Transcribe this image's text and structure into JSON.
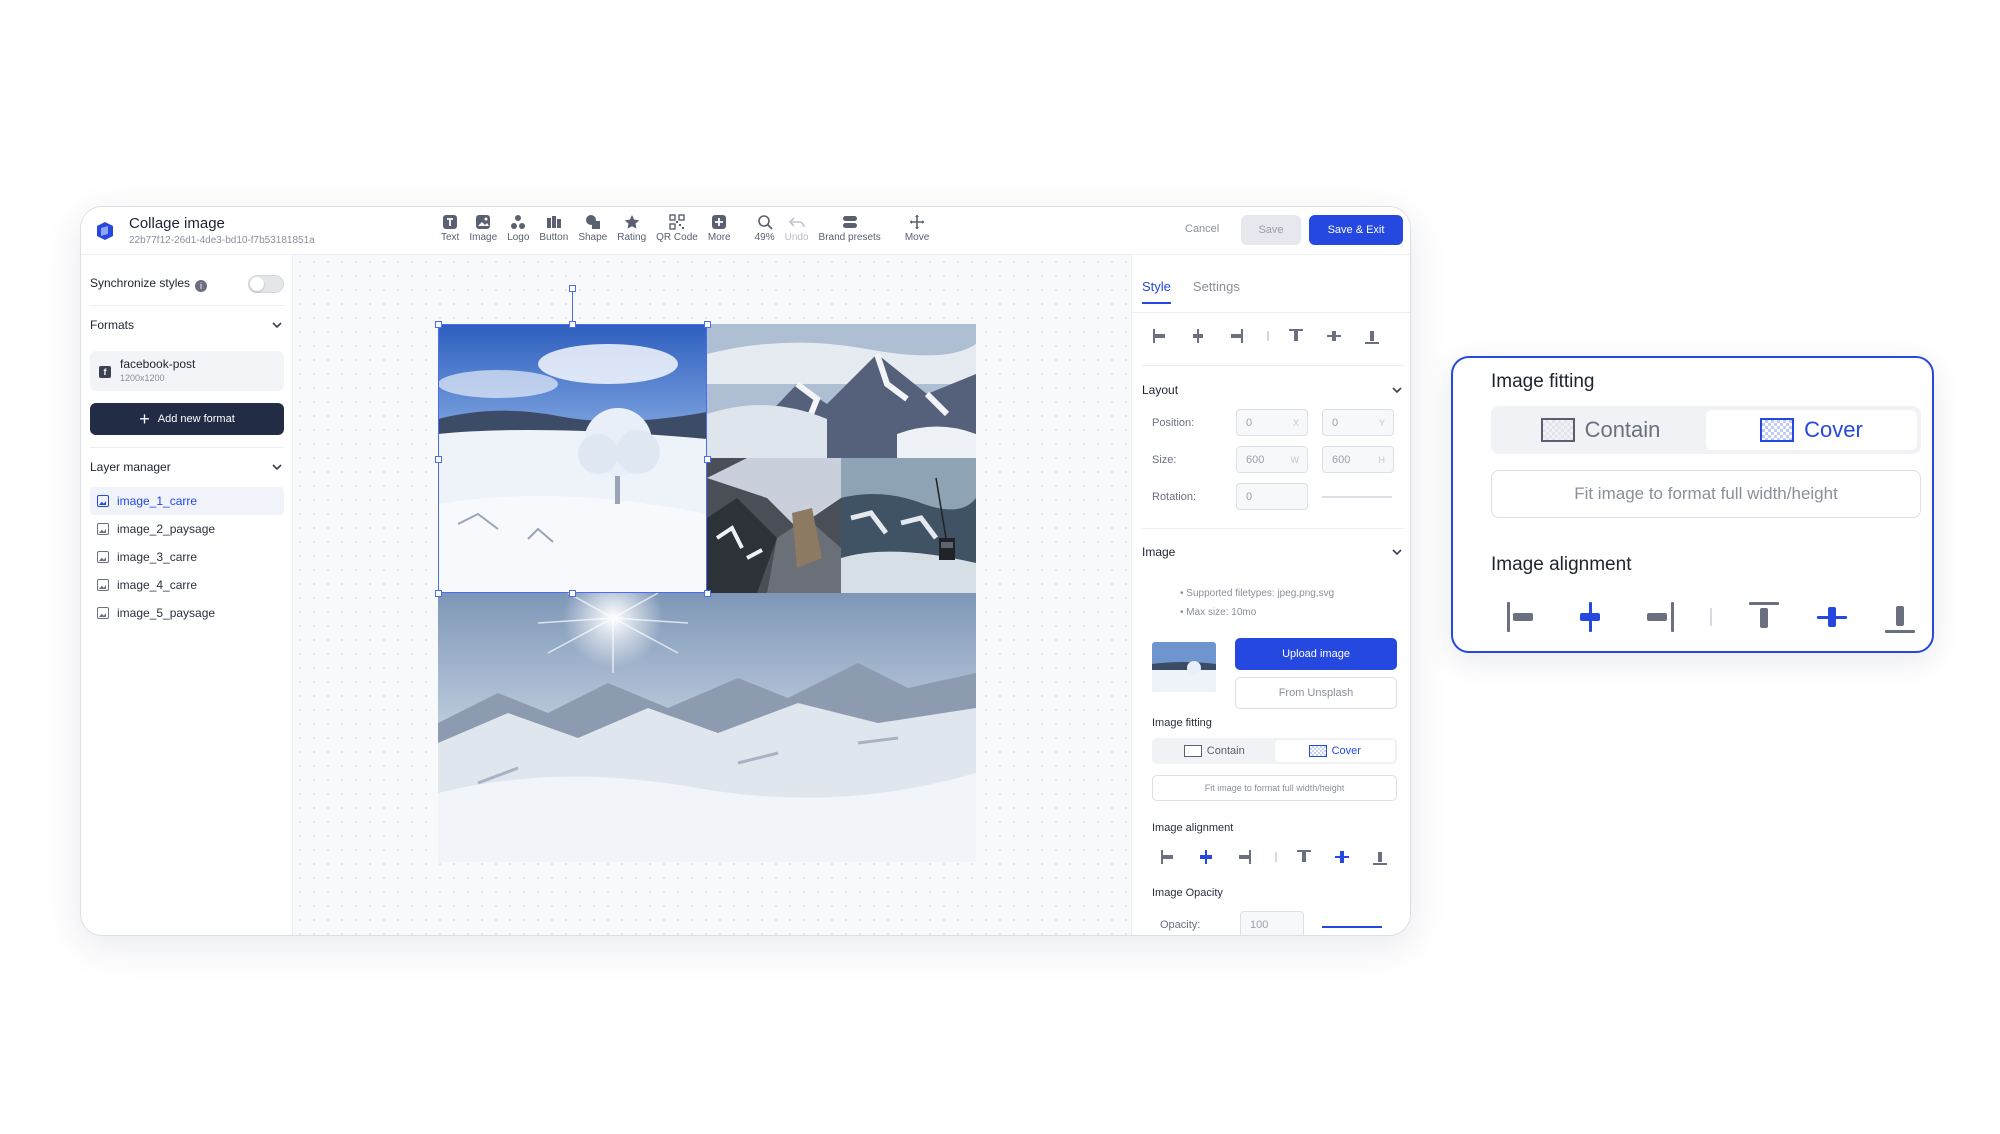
{
  "header": {
    "title": "Collage image",
    "subtitle": "22b77f12-26d1-4de3-bd10-f7b53181851a",
    "cancel_label": "Cancel",
    "save_label": "Save",
    "save_exit_label": "Save & Exit"
  },
  "toolbar": {
    "text": "Text",
    "image": "Image",
    "logo": "Logo",
    "button": "Button",
    "shape": "Shape",
    "rating": "Rating",
    "qrcode": "QR Code",
    "more": "More",
    "zoom": "49%",
    "undo": "Undo",
    "brand_presets": "Brand presets",
    "move": "Move"
  },
  "left": {
    "sync_label": "Synchronize styles",
    "formats_title": "Formats",
    "format": {
      "name": "facebook-post",
      "size": "1200x1200",
      "badge": "f"
    },
    "add_format": "Add new format",
    "layer_title": "Layer manager",
    "layers": [
      "image_1_carre",
      "image_2_paysage",
      "image_3_carre",
      "image_4_carre",
      "image_5_paysage"
    ]
  },
  "right": {
    "tabs": [
      "Style",
      "Settings"
    ],
    "layout_title": "Layout",
    "position_label": "Position:",
    "position_x": "0",
    "position_y": "0",
    "size_label": "Size:",
    "size_w": "600",
    "size_h": "600",
    "rotation_label": "Rotation:",
    "rotation": "0",
    "units": {
      "x": "X",
      "y": "Y",
      "w": "W",
      "h": "H"
    },
    "image_title": "Image",
    "bullets": [
      "Supported filetypes: jpeg,png,svg",
      "Max size: 10mo"
    ],
    "upload": "Upload image",
    "unsplash": "From Unsplash",
    "fitting_label": "Image fitting",
    "contain": "Contain",
    "cover": "Cover",
    "fit_full": "Fit image to format full width/height",
    "alignment_label": "Image alignment",
    "opacity_title": "Image Opacity",
    "opacity_label": "Opacity:",
    "opacity": "100"
  },
  "zoom_card": {
    "fitting_title": "Image fitting",
    "contain": "Contain",
    "cover": "Cover",
    "fit_full": "Fit image to format full width/height",
    "alignment_title": "Image alignment"
  },
  "colors": {
    "accent": "#2448e0",
    "dark_button": "#222d45"
  }
}
